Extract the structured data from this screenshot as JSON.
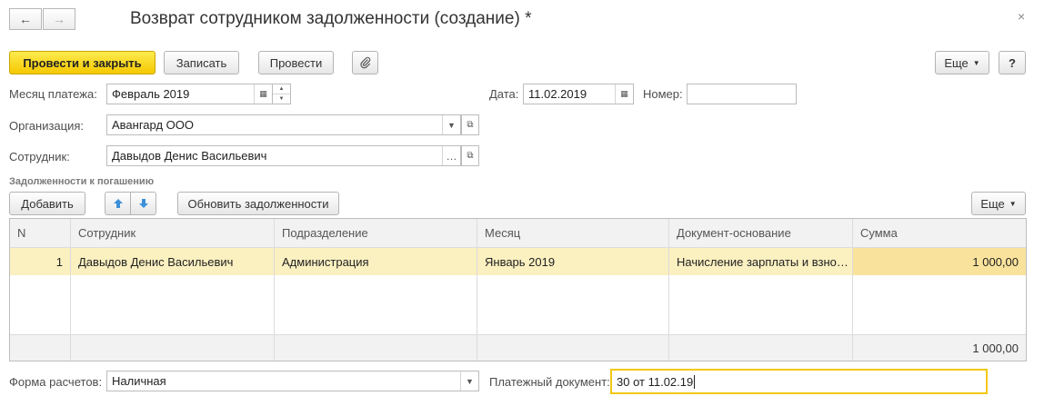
{
  "window": {
    "title": "Возврат сотрудником задолженности (создание) *",
    "back_icon": "←",
    "forward_icon": "→",
    "close_icon": "×"
  },
  "toolbar": {
    "post_close": "Провести и закрыть",
    "save": "Записать",
    "post": "Провести",
    "attach_icon": "paperclip-icon",
    "more": "Еще",
    "help": "?"
  },
  "form": {
    "month_label": "Месяц платежа:",
    "month_value": "Февраль 2019",
    "date_label": "Дата:",
    "date_value": "11.02.2019",
    "number_label": "Номер:",
    "number_value": "",
    "org_label": "Организация:",
    "org_value": "Авангард ООО",
    "employee_label": "Сотрудник:",
    "employee_value": "Давыдов Денис Васильевич"
  },
  "section": {
    "title": "Задолженности к погашению",
    "add": "Добавить",
    "refresh": "Обновить задолженности",
    "more": "Еще"
  },
  "table": {
    "columns": [
      "N",
      "Сотрудник",
      "Подразделение",
      "Месяц",
      "Документ-основание",
      "Сумма"
    ],
    "rows": [
      {
        "n": "1",
        "employee": "Давыдов Денис Васильевич",
        "department": "Администрация",
        "month": "Январь 2019",
        "document": "Начисление зарплаты и взно…",
        "sum": "1 000,00"
      }
    ],
    "total": "1 000,00"
  },
  "footer": {
    "payment_form_label": "Форма расчетов:",
    "payment_form_value": "Наличная",
    "payment_doc_label": "Платежный документ:",
    "payment_doc_value": "30 от 11.02.19"
  },
  "colors": {
    "primary_button": "#f5c800",
    "selected_row": "#fbf0c0",
    "focus_border": "#f2c811"
  }
}
